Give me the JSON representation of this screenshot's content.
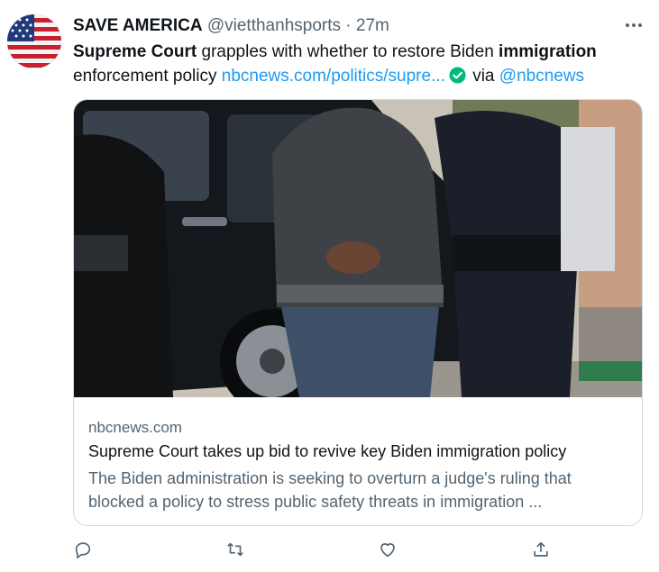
{
  "tweet": {
    "display_name": "SAVE AMERICA",
    "handle": "@vietthanhsports",
    "separator": "·",
    "time": "27m",
    "text_bold_1": "Supreme Court",
    "text_plain_1": " grapples with whether to restore Biden ",
    "text_bold_2": "immigration",
    "text_plain_2": "enforcement policy ",
    "link": "nbcnews.com/politics/supre...",
    "via_label": " via ",
    "via_handle": "@nbcnews"
  },
  "card": {
    "domain": "nbcnews.com",
    "title": "Supreme Court takes up bid to revive key Biden immigration policy",
    "description": "The Biden administration is seeking to overturn a judge's ruling that blocked a policy to stress public safety threats in immigration ..."
  },
  "icons": {
    "more": "more-icon",
    "verified": "verified-check-icon",
    "reply": "reply-icon",
    "retweet": "retweet-icon",
    "like": "like-icon",
    "share": "share-icon"
  },
  "colors": {
    "link": "#1d9bf0",
    "muted": "#536471",
    "text": "#0f1419",
    "verified": "#00ba7c",
    "border": "#cfd9de"
  }
}
